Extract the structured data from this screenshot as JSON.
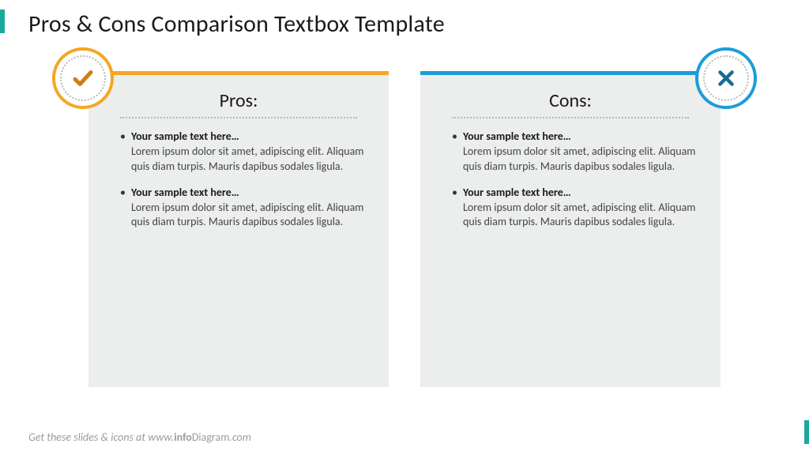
{
  "title": "Pros & Cons Comparison Textbox Template",
  "accentColor": "#1aa99d",
  "panels": {
    "pros": {
      "heading": "Pros:",
      "color": "#f5a623",
      "iconColor": "#c9801a",
      "items": [
        {
          "title": "Your sample text here…",
          "body": "Lorem ipsum dolor sit amet, adipiscing elit. Aliquam quis diam turpis. Mauris dapibus sodales ligula."
        },
        {
          "title": "Your sample text here…",
          "body": "Lorem ipsum dolor sit amet, adipiscing elit. Aliquam quis diam turpis. Mauris dapibus sodales ligula."
        }
      ]
    },
    "cons": {
      "heading": "Cons:",
      "color": "#1b9dd9",
      "iconColor": "#146b96",
      "items": [
        {
          "title": "Your sample text here…",
          "body": "Lorem ipsum dolor sit amet, adipiscing elit. Aliquam quis diam turpis. Mauris dapibus sodales ligula."
        },
        {
          "title": "Your sample text here…",
          "body": "Lorem ipsum dolor sit amet, adipiscing elit. Aliquam quis diam turpis. Mauris dapibus sodales ligula."
        }
      ]
    }
  },
  "footer": {
    "prefix": "Get these slides & icons at www.",
    "brandA": "info",
    "brandB": "Diagram",
    "suffix": ".com"
  }
}
